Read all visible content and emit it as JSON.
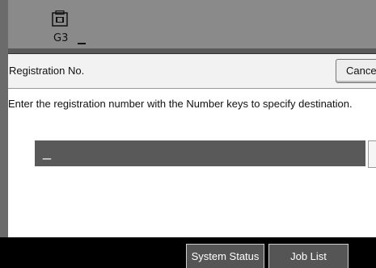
{
  "background": {
    "line_label": "G3",
    "line_indicator": "_"
  },
  "dialog": {
    "title": "Registration No.",
    "cancel_label": "Cancel",
    "instruction": "Enter the registration number with the Number keys to specify destination.",
    "entry_value": "_"
  },
  "footer": {
    "system_status_label": "System Status",
    "job_list_label": "Job List"
  },
  "icons": {
    "fax_line_icon": "fax-line-icon"
  },
  "colors": {
    "entry_field": "#595959",
    "footer_background": "#000000"
  }
}
